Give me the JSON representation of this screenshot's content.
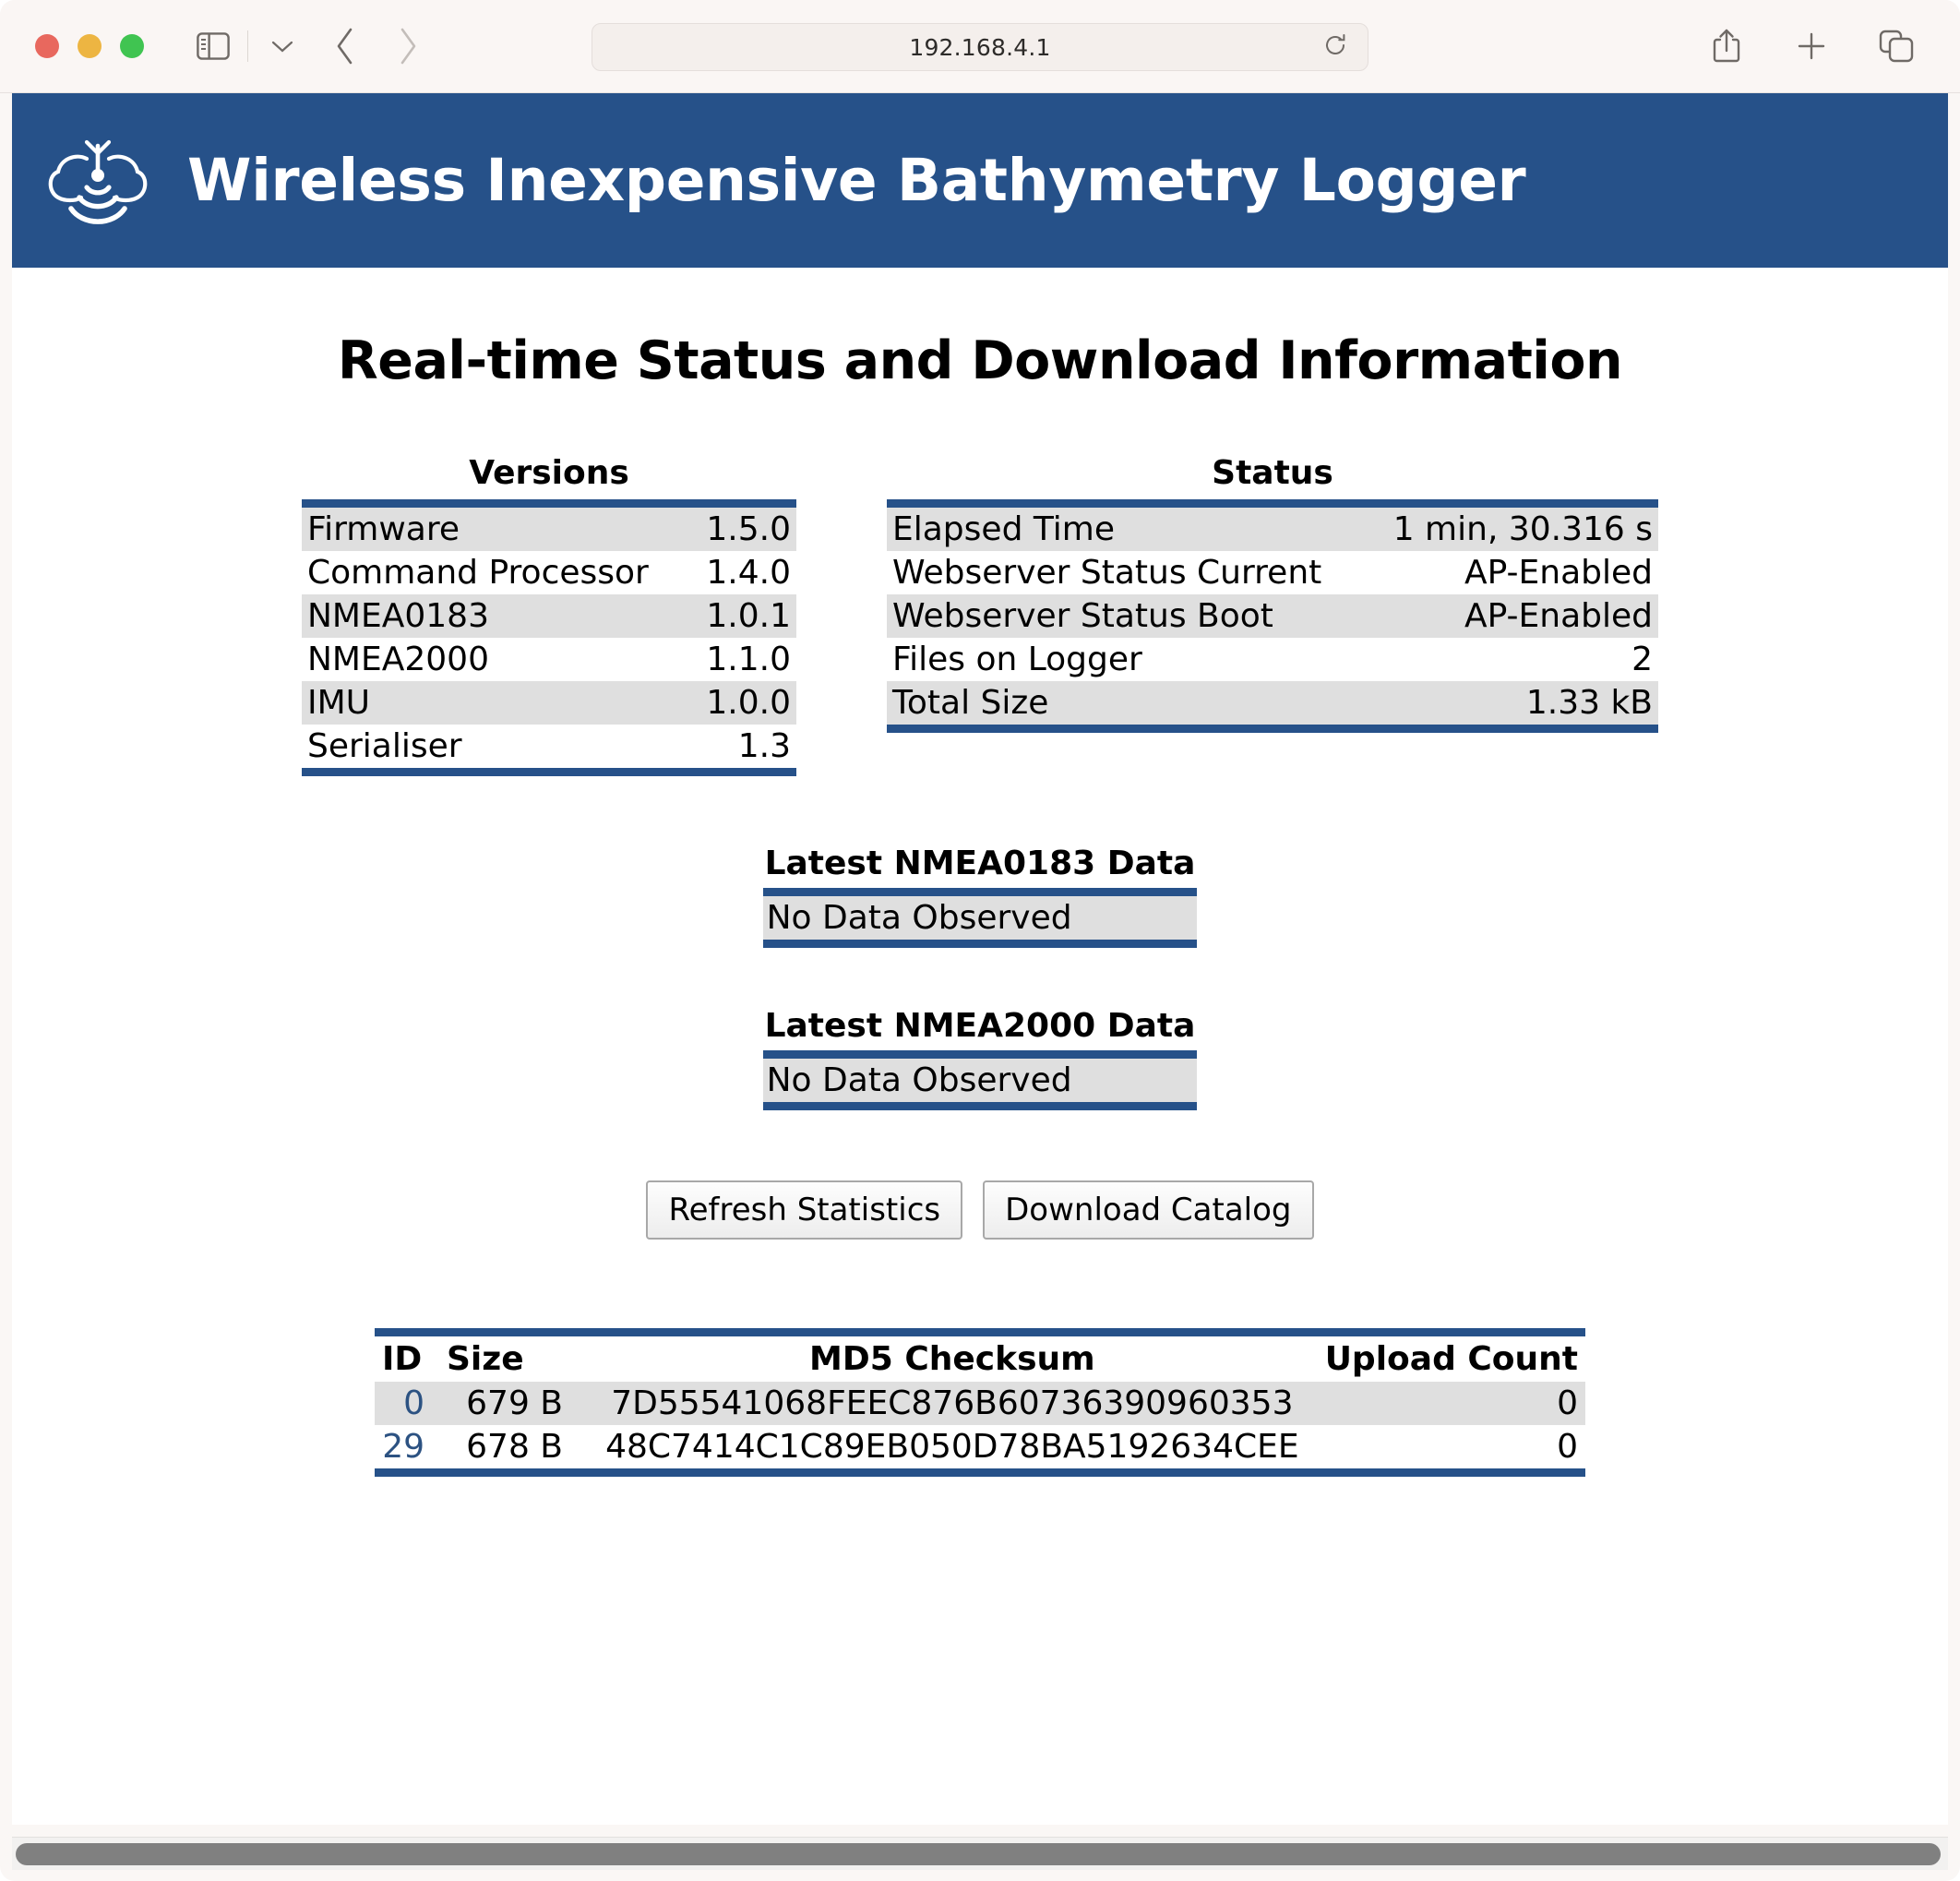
{
  "browser": {
    "url": "192.168.4.1",
    "traffic_lights": [
      "close",
      "minimize",
      "maximize"
    ],
    "icons": {
      "sidebar": "sidebar-icon",
      "chevron_down": "chevron-down-icon",
      "back": "back-arrow-icon",
      "forward": "forward-arrow-icon",
      "reload": "reload-icon",
      "share": "share-icon",
      "new_tab": "plus-icon",
      "tab_overview": "tab-overview-icon"
    }
  },
  "banner": {
    "title": "Wireless Inexpensive Bathymetry Logger",
    "logo_icon": "cloud-sonar-logo-icon",
    "background_color": "#265189",
    "text_color": "#ffffff"
  },
  "page": {
    "heading": "Real-time Status and Download Information",
    "accent_color": "#265189",
    "row_shade_color": "#dfdfdf",
    "link_color": "#2c5282"
  },
  "versions_table": {
    "caption": "Versions",
    "rows": [
      {
        "name": "Firmware",
        "value": "1.5.0"
      },
      {
        "name": "Command Processor",
        "value": "1.4.0"
      },
      {
        "name": "NMEA0183",
        "value": "1.0.1"
      },
      {
        "name": "NMEA2000",
        "value": "1.1.0"
      },
      {
        "name": "IMU",
        "value": "1.0.0"
      },
      {
        "name": "Serialiser",
        "value": "1.3"
      }
    ]
  },
  "status_table": {
    "caption": "Status",
    "rows": [
      {
        "name": "Elapsed Time",
        "value": "1 min, 30.316 s"
      },
      {
        "name": "Webserver Status Current",
        "value": "AP-Enabled"
      },
      {
        "name": "Webserver Status Boot",
        "value": "AP-Enabled"
      },
      {
        "name": "Files on Logger",
        "value": "2"
      },
      {
        "name": "Total Size",
        "value": "1.33 kB"
      }
    ]
  },
  "nmea0183_table": {
    "caption": "Latest NMEA0183 Data",
    "value": "No Data Observed"
  },
  "nmea2000_table": {
    "caption": "Latest NMEA2000 Data",
    "value": "No Data Observed"
  },
  "buttons": {
    "refresh": "Refresh Statistics",
    "download_catalog": "Download Catalog"
  },
  "files_table": {
    "columns": {
      "id": "ID",
      "size": "Size",
      "md5": "MD5 Checksum",
      "upload_count": "Upload Count"
    },
    "rows": [
      {
        "id": "0",
        "size": "679 B",
        "md5": "7D55541068FEEC876B60736390960353",
        "upload_count": "0"
      },
      {
        "id": "29",
        "size": "678 B",
        "md5": "48C7414C1C89EB050D78BA5192634CEE",
        "upload_count": "0"
      }
    ]
  }
}
